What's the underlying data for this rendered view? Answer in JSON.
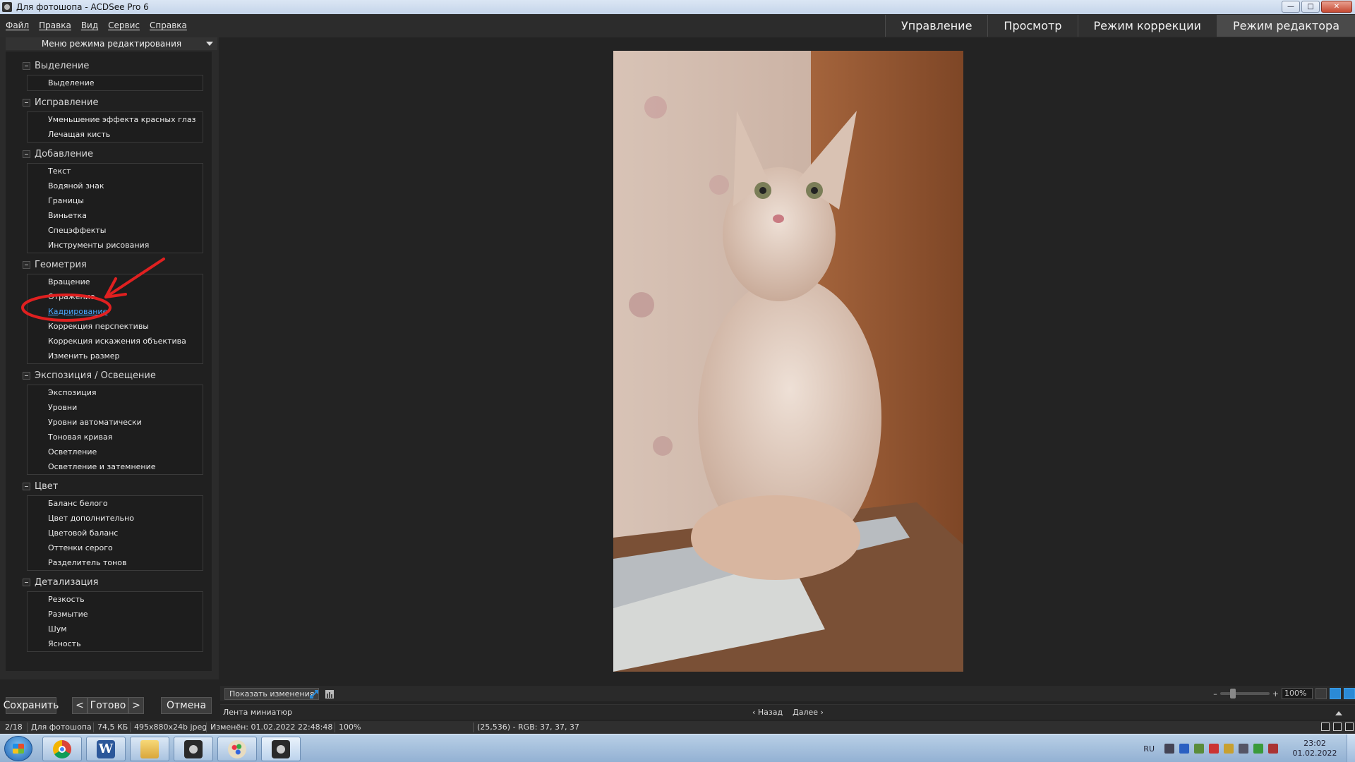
{
  "window": {
    "title": "Для фотошопа - ACDSee Pro 6",
    "min": "—",
    "max": "□",
    "close": "✕"
  },
  "menubar": [
    "Файл",
    "Правка",
    "Вид",
    "Сервис",
    "Справка"
  ],
  "mode_tabs": [
    {
      "label": "Управление",
      "active": false
    },
    {
      "label": "Просмотр",
      "active": false
    },
    {
      "label": "Режим коррекции",
      "active": false
    },
    {
      "label": "Режим редактора",
      "active": true
    }
  ],
  "edit_menu": {
    "title": "Меню режима редактирования",
    "sections": [
      {
        "title": "Выделение",
        "items": [
          "Выделение"
        ]
      },
      {
        "title": "Исправление",
        "items": [
          "Уменьшение эффекта красных глаз",
          "Лечащая кисть"
        ]
      },
      {
        "title": "Добавление",
        "items": [
          "Текст",
          "Водяной знак",
          "Границы",
          "Виньетка",
          "Спецэффекты",
          "Инструменты рисования"
        ]
      },
      {
        "title": "Геометрия",
        "items": [
          "Вращение",
          "Отражение",
          "Кадрирование",
          "Коррекция перспективы",
          "Коррекция искажения объектива",
          "Изменить размер"
        ]
      },
      {
        "title": "Экспозиция / Освещение",
        "items": [
          "Экспозиция",
          "Уровни",
          "Уровни автоматически",
          "Тоновая кривая",
          "Осветление",
          "Осветление и затемнение"
        ]
      },
      {
        "title": "Цвет",
        "items": [
          "Баланс белого",
          "Цвет дополнительно",
          "Цветовой баланс",
          "Оттенки серого",
          "Разделитель тонов"
        ]
      },
      {
        "title": "Детализация",
        "items": [
          "Резкость",
          "Размытие",
          "Шум",
          "Ясность"
        ]
      }
    ],
    "highlighted_item": "Кадрирование"
  },
  "buttons": {
    "save": "Сохранить",
    "done": "Готово",
    "prev": "<",
    "next": ">",
    "cancel": "Отмена"
  },
  "toolbar": {
    "show_changes": "Показать изменения",
    "zoom": "100%"
  },
  "filmstrip": {
    "label": "Лента миниатюр",
    "back": "‹ Назад",
    "forward": "Далее ›"
  },
  "status": {
    "index": "2/18",
    "folder": "Для фотошопа",
    "size": "74,5 КБ",
    "dims": "495x880x24b jpeg",
    "modified": "Изменён: 01.02.2022 22:48:48",
    "zoom": "100%",
    "pixel": "(25,536) - RGB: 37, 37, 37"
  },
  "taskbar": {
    "apps": [
      "chrome-icon",
      "word-icon",
      "explorer-icon",
      "acdsee-icon",
      "paint-icon",
      "acdsee-active-icon"
    ],
    "lang": "RU",
    "time": "23:02",
    "date": "01.02.2022"
  },
  "colors": {
    "accent": "#2b8ad6",
    "link": "#4aa8ff",
    "annotation": "#e02020"
  }
}
